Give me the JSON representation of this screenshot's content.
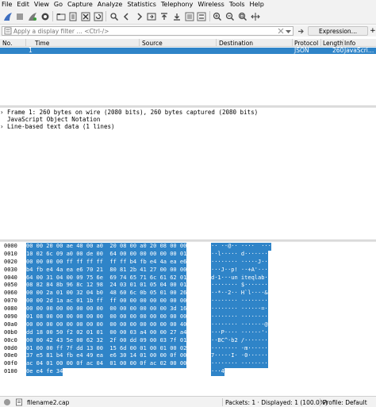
{
  "menu": [
    "File",
    "Edit",
    "View",
    "Go",
    "Capture",
    "Analyze",
    "Statistics",
    "Telephony",
    "Wireless",
    "Tools",
    "Help"
  ],
  "toolbar": {
    "icons": [
      "shark-fin-start-icon",
      "stop-icon",
      "restart-icon",
      "options-gear-icon",
      "open-folder-icon",
      "save-file-icon",
      "close-file-icon",
      "reload-icon",
      "find-icon",
      "go-back-icon",
      "go-forward-icon",
      "go-to-packet-icon",
      "go-first-icon",
      "go-last-icon",
      "autoscroll-icon",
      "colorize-icon",
      "zoom-in-icon",
      "zoom-out-icon",
      "zoom-reset-icon",
      "resize-columns-icon"
    ]
  },
  "filter": {
    "placeholder": "Apply a display filter … <Ctrl-/>",
    "value": "",
    "expression_label": "Expression…",
    "add_label": "+"
  },
  "packet_list": {
    "columns": [
      "No.",
      "Time",
      "Source",
      "Destination",
      "Protocol",
      "Length",
      "Info"
    ],
    "rows": [
      {
        "no": "1",
        "time": "",
        "source": "",
        "destination": "",
        "protocol": "JSON",
        "length": "260",
        "info": "JavaScri…"
      }
    ]
  },
  "details": {
    "lines": [
      "› Frame 1: 260 bytes on wire (2080 bits), 260 bytes captured (2080 bits)",
      "  JavaScript Object Notation",
      "› Line-based text data (1 lines)"
    ]
  },
  "bytes": {
    "rows": [
      {
        "offset": "0000",
        "hex": "00 00 20 00 ae 40 00 a0  20 08 00 a0 20 08 00 00",
        "ascii": "·· ··@·· ····  ···"
      },
      {
        "offset": "0010",
        "hex": "10 02 6c 09 a0 00 de 00  64 00 00 00 00 00 00 01",
        "ascii": "··l····· d·······"
      },
      {
        "offset": "0020",
        "hex": "00 00 00 00 ff ff ff ff  ff ff b4 fb e4 4a ea e6",
        "ascii": "········ ·····J··"
      },
      {
        "offset": "0030",
        "hex": "b4 fb e4 4a ea e6 70 21  80 81 2b 41 27 00 00 00",
        "ascii": "···J··p! ··+A'···"
      },
      {
        "offset": "0040",
        "hex": "64 00 31 04 00 09 75 6e  69 74 65 71 6c 61 62 01",
        "ascii": "d·1···un iteqlab·"
      },
      {
        "offset": "0050",
        "hex": "08 82 84 8b 96 8c 12 98  24 03 01 01 05 04 00 01",
        "ascii": "········ $·······"
      },
      {
        "offset": "0060",
        "hex": "00 00 2a 01 00 32 04 b0  48 60 6c 0b 05 01 00 26",
        "ascii": "··*··2·· H`l····&"
      },
      {
        "offset": "0070",
        "hex": "00 00 2d 1a ac 01 1b ff  ff 00 00 00 00 00 00 00",
        "ascii": "··-····· ········"
      },
      {
        "offset": "0080",
        "hex": "00 00 00 00 00 00 00 00  00 00 00 00 00 00 3d 16",
        "ascii": "········ ······=·"
      },
      {
        "offset": "0090",
        "hex": "01 08 00 00 00 00 00 00  00 00 00 00 00 00 00 00",
        "ascii": "········ ········"
      },
      {
        "offset": "00a0",
        "hex": "00 00 00 00 00 00 00 00  00 00 00 00 00 00 00 40",
        "ascii": "········ ·······@"
      },
      {
        "offset": "00b0",
        "hex": "dd 18 00 50 f2 02 01 01  00 00 03 a4 00 00 27 a4",
        "ascii": "···P···· ······'·"
      },
      {
        "offset": "00c0",
        "hex": "00 00 42 43 5e 00 62 32  2f 00 dd 09 00 03 7f 01",
        "ascii": "··BC^·b2 /·······"
      },
      {
        "offset": "00d0",
        "hex": "01 00 00 ff 7f dd 13 00  15 6d 00 01 00 01 00 02",
        "ascii": "········ ·m······"
      },
      {
        "offset": "00e0",
        "hex": "37 e5 81 b4 fb e4 49 ea  e6 30 14 01 00 00 0f 00",
        "ascii": "7·····I· ·0······"
      },
      {
        "offset": "00f0",
        "hex": "ac 04 01 00 00 0f ac 04  01 00 00 0f ac 02 00 00",
        "ascii": "········ ········"
      },
      {
        "offset": "0100",
        "hex": "0e e4 fe 34",
        "ascii": "···4"
      }
    ]
  },
  "status": {
    "file": "filename2.cap",
    "packets": "Packets: 1 · Displayed: 1 (100.0%)",
    "profile": "Profile: Default"
  },
  "colors": {
    "selection": "#2f84c8",
    "shark_blue": "#3f6fc0",
    "stop_red": "#d42b2b",
    "filter_green": "#3a9c3a"
  }
}
